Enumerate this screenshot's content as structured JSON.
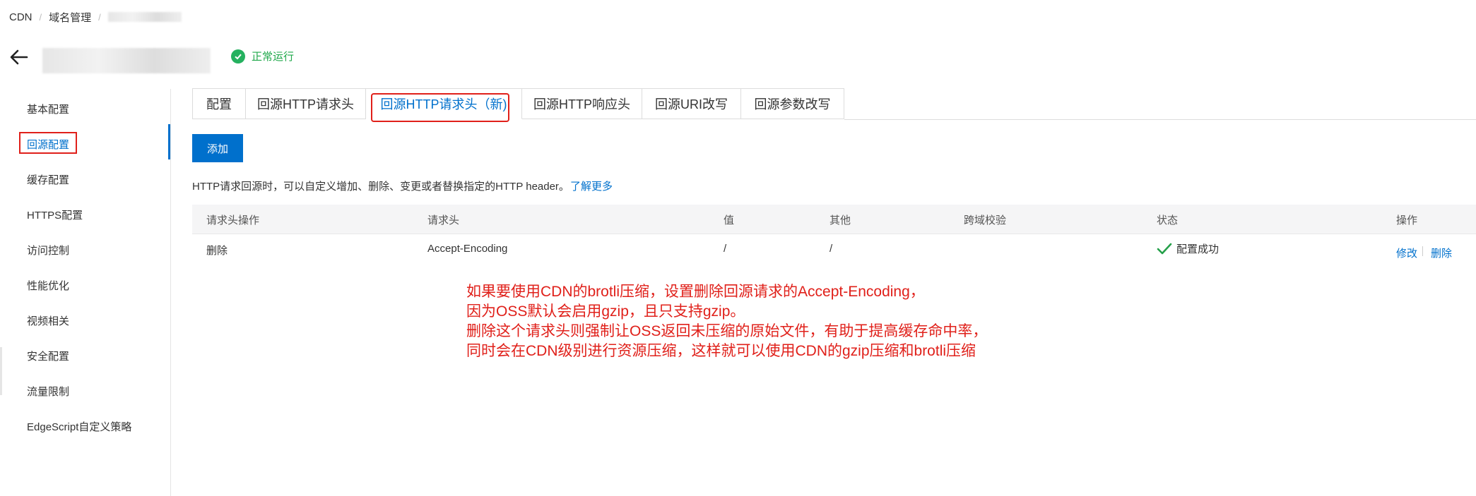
{
  "breadcrumb": {
    "items": [
      "CDN",
      "域名管理"
    ]
  },
  "header": {
    "status": "正常运行"
  },
  "colors": {
    "primary": "#0070cc",
    "success": "#25b15f",
    "annotation": "#e0201a"
  },
  "icons": {
    "back": "arrow-left-icon",
    "status": "check-circle-icon",
    "table_status": "check-icon"
  },
  "sidebar": {
    "items": [
      {
        "label": "基本配置"
      },
      {
        "label": "回源配置"
      },
      {
        "label": "缓存配置"
      },
      {
        "label": "HTTPS配置"
      },
      {
        "label": "访问控制"
      },
      {
        "label": "性能优化"
      },
      {
        "label": "视频相关"
      },
      {
        "label": "安全配置"
      },
      {
        "label": "流量限制"
      },
      {
        "label": "EdgeScript自定义策略"
      }
    ],
    "active_index": 1
  },
  "tabs": [
    {
      "label": "配置"
    },
    {
      "label": "回源HTTP请求头"
    },
    {
      "label": "回源HTTP请求头（新)"
    },
    {
      "label": "回源HTTP响应头"
    },
    {
      "label": "回源URI改写"
    },
    {
      "label": "回源参数改写"
    }
  ],
  "actions": {
    "add": "添加"
  },
  "description": {
    "text": "HTTP请求回源时，可以自定义增加、删除、变更或者替换指定的HTTP header。",
    "learn_more": "了解更多"
  },
  "table": {
    "headers": [
      "请求头操作",
      "请求头",
      "值",
      "其他",
      "跨域校验",
      "状态",
      "操作"
    ],
    "rows": [
      {
        "operation": "删除",
        "header": "Accept-Encoding",
        "value": "/",
        "other": "/",
        "cors": "",
        "status": "配置成功",
        "actions": [
          "修改",
          "删除"
        ]
      }
    ]
  },
  "annotation": {
    "lines": [
      "如果要使用CDN的brotli压缩，设置删除回源请求的Accept-Encoding，",
      "因为OSS默认会启用gzip，且只支持gzip。",
      "删除这个请求头则强制让OSS返回未压缩的原始文件，有助于提高缓存命中率，",
      "同时会在CDN级别进行资源压缩，这样就可以使用CDN的gzip压缩和brotli压缩"
    ]
  }
}
